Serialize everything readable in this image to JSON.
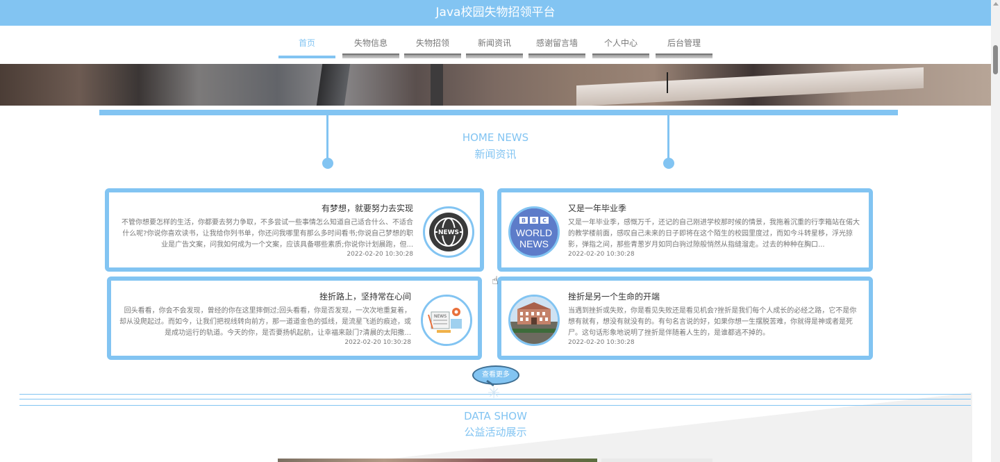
{
  "header": {
    "title": "Java校园失物招领平台"
  },
  "nav": {
    "items": [
      {
        "label": "首页",
        "active": true
      },
      {
        "label": "失物信息",
        "active": false
      },
      {
        "label": "失物招领",
        "active": false
      },
      {
        "label": "新闻资讯",
        "active": false
      },
      {
        "label": "感谢留言墙",
        "active": false
      },
      {
        "label": "个人中心",
        "active": false
      },
      {
        "label": "后台管理",
        "active": false
      }
    ]
  },
  "news_section": {
    "title_en": "HOME NEWS",
    "title_cn": "新闻资讯",
    "cards": [
      {
        "title": "有梦想，就要努力去实现",
        "body": "不管你想要怎样的生活，你都要去努力争取，不多尝试一些事情怎么知道自己适合什么、不适合什么呢?你说你喜欢读书，让我给你列书单，你还问我哪里有那么多时间看书;你说自己梦想的职业是广告文案，问我如何成为一个文案，应该具备哪些素质;你说你计划晨跑，但...",
        "date": "2022-02-20 10:30:28",
        "icon": "news-globe-icon"
      },
      {
        "title": "又是一年毕业季",
        "body": "又是一年毕业季，感慨万千，还记的自己刚进学校那时候的情景，我拖着沉重的行李箱站在偌大的教学楼前面，感叹自己未来的日子即将在这个陌生的校园里度过，而如今斗转星移，浮光掠影，弹指之间，那些青葱岁月如同白驹过隙般悄然从指缝溜走。过去的种种在胸口...",
        "date": "2022-02-20 10:30:28",
        "icon": "bbc-world-news-icon"
      },
      {
        "title": "挫折路上，坚持常在心间",
        "body": "回头看看，你会不会发现，曾经的你在这里摔倒过;回头看看，你是否发现，一次次地重复着，却从没爬起过。而如今，让我们把视线转向前方，那一道道金色的弧线，是流星飞逝的痕迹，或是成功运行的轨道。今天的你，是否要扬帆起航，让幸福来敲门?清晨的太阳撒...",
        "date": "2022-02-20 10:30:28",
        "icon": "news-illustration-icon"
      },
      {
        "title": "挫折是另一个生命的开端",
        "body": "当遇到挫折或失败，你是看见失败还是看见机会?挫折是我们每个人成长的必经之路，它不是你想有就有，想没有就没有的。有句名言说的好，如果你想一生摆脱苦难，你就得是神或者是死尸。这句话形象地说明了挫折是伴随着人生的，是谁都逃不掉的。",
        "date": "2022-02-20 10:30:28",
        "icon": "campus-building-icon"
      }
    ],
    "more_button": "查看更多"
  },
  "data_section": {
    "title_en": "DATA SHOW",
    "title_cn": "公益活动展示"
  },
  "colors": {
    "accent": "#82c4f2",
    "text": "#333333",
    "muted": "#777777"
  }
}
